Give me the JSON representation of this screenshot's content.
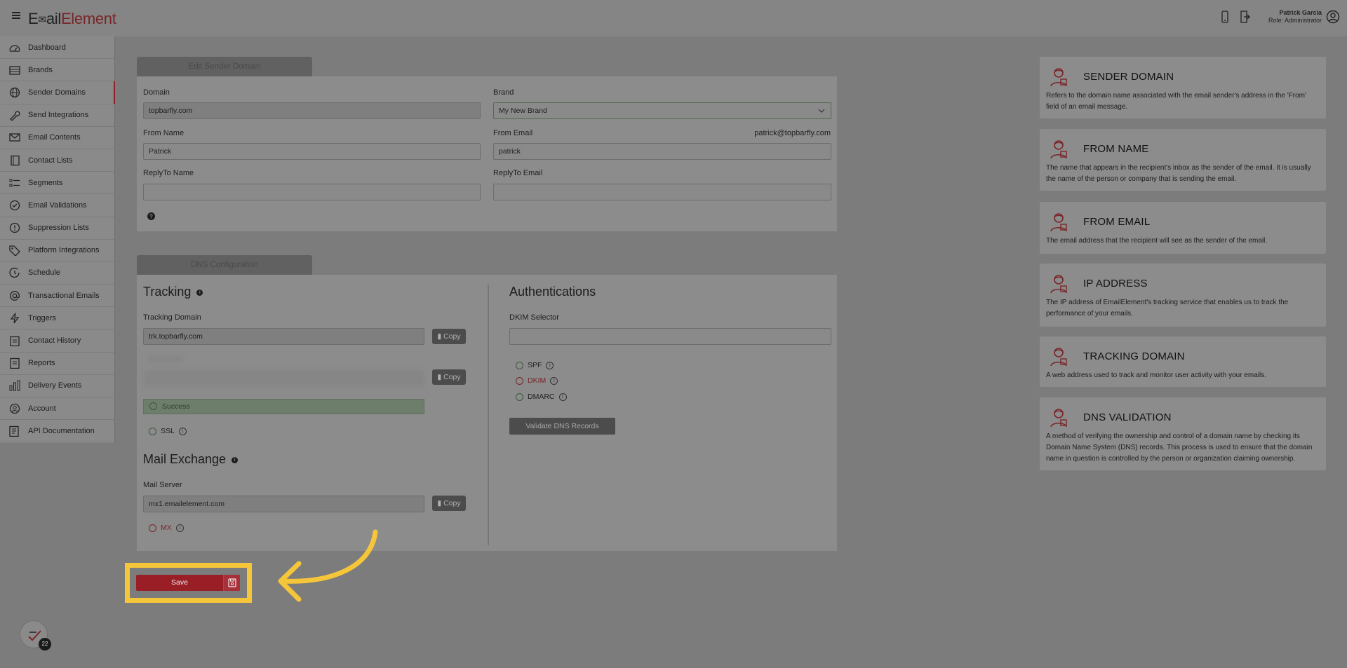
{
  "app": {
    "logo_prefix": "E",
    "logo_mid": "ail",
    "logo_accent": "Element"
  },
  "user": {
    "name": "Patrick Garcia",
    "role": "Role: Administrator"
  },
  "sidebar": {
    "items": [
      {
        "label": "Dashboard",
        "icon": "dashboard-icon"
      },
      {
        "label": "Brands",
        "icon": "brands-icon"
      },
      {
        "label": "Sender Domains",
        "icon": "globe-icon"
      },
      {
        "label": "Send Integrations",
        "icon": "wrench-icon"
      },
      {
        "label": "Email Contents",
        "icon": "envelope-icon"
      },
      {
        "label": "Contact Lists",
        "icon": "book-icon"
      },
      {
        "label": "Segments",
        "icon": "list-icon"
      },
      {
        "label": "Email Validations",
        "icon": "check-circle-icon"
      },
      {
        "label": "Suppression Lists",
        "icon": "exclamation-icon"
      },
      {
        "label": "Platform Integrations",
        "icon": "tag-icon"
      },
      {
        "label": "Schedule",
        "icon": "clock-icon"
      },
      {
        "label": "Transactional Emails",
        "icon": "at-icon"
      },
      {
        "label": "Triggers",
        "icon": "bolt-icon"
      },
      {
        "label": "Contact History",
        "icon": "clipboard-icon"
      },
      {
        "label": "Reports",
        "icon": "report-icon"
      },
      {
        "label": "Delivery Events",
        "icon": "bars-icon"
      },
      {
        "label": "Account",
        "icon": "user-icon"
      },
      {
        "label": "API Documentation",
        "icon": "document-icon"
      }
    ],
    "active_index": 2,
    "notification_count": "22"
  },
  "edit_sender": {
    "tab": "Edit Sender Domain",
    "domain_label": "Domain",
    "domain_value": "topbarfly.com",
    "brand_label": "Brand",
    "brand_value": "My New Brand",
    "from_name_label": "From Name",
    "from_name_value": "Patrick",
    "from_email_label": "From Email",
    "from_email_preview": "patrick@topbarfly.com",
    "from_email_value": "patrick",
    "replyto_name_label": "ReplyTo Name",
    "replyto_name_value": "",
    "replyto_email_label": "ReplyTo Email",
    "replyto_email_value": ""
  },
  "dns": {
    "tab": "DNS Configuration",
    "tracking_title": "Tracking",
    "tracking_domain_label": "Tracking Domain",
    "tracking_domain_value": "trk.topbarfly.com",
    "copy_label": "Copy",
    "success_text": "Success",
    "ssl_label": "SSL",
    "mail_exchange_title": "Mail Exchange",
    "mail_server_label": "Mail Server",
    "mail_server_value": "mx1.emailelement.com",
    "mx_label": "MX",
    "auth_title": "Authentications",
    "dkim_selector_label": "DKIM Selector",
    "dkim_selector_value": "",
    "spf_label": "SPF",
    "dkim_label": "DKIM",
    "dmarc_label": "DMARC",
    "validate_label": "Validate DNS Records"
  },
  "info_cards": [
    {
      "title": "SENDER DOMAIN",
      "desc": "Refers to the domain name associated with the email sender's address in the 'From' field of an email message."
    },
    {
      "title": "FROM NAME",
      "desc": "The name that appears in the recipient's inbox as the sender of the email. It is usually the name of the person or company that is sending the email."
    },
    {
      "title": "FROM EMAIL",
      "desc": "The email address that the recipient will see as the sender of the email."
    },
    {
      "title": "IP ADDRESS",
      "desc": "The IP address of EmailElement's tracking service that enables us to track the performance of your emails."
    },
    {
      "title": "TRACKING DOMAIN",
      "desc": "A web address used to track and monitor user activity with your emails."
    },
    {
      "title": "DNS VALIDATION",
      "desc": "A method of verifying the ownership and control of a domain name by checking its Domain Name System (DNS) records. This process is used to ensure that the domain name in question is controlled by the person or organization claiming ownership."
    }
  ],
  "save": {
    "label": "Save"
  },
  "colors": {
    "accent": "#9a1e26",
    "highlight": "#f6c63a",
    "success": "#3c5a3c"
  }
}
